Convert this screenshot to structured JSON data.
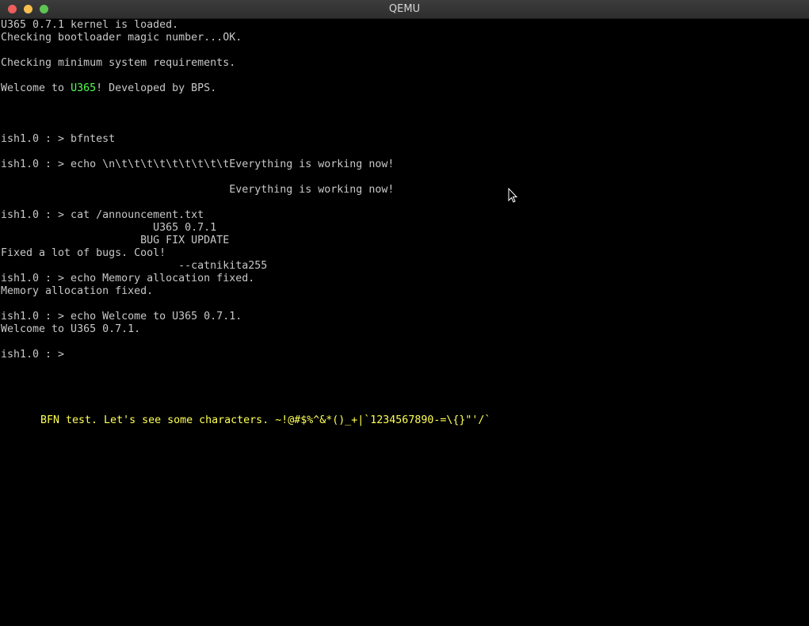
{
  "window": {
    "title": "QEMU",
    "buttons": {
      "close_color": "#ec5f5d",
      "minimize_color": "#f7bf4f",
      "maximize_color": "#5fc454"
    }
  },
  "terminal": {
    "lines": [
      "U365 0.7.1 kernel is loaded.",
      "Checking bootloader magic number...OK.",
      "",
      "Checking minimum system requirements.",
      "",
      "",
      "",
      "",
      "",
      "ish1.0 : > bfntest",
      "",
      "ish1.0 : > echo \\n\\t\\t\\t\\t\\t\\t\\t\\t\\tEverything is working now!",
      "",
      "                                    Everything is working now!",
      "",
      "ish1.0 : > cat /announcement.txt",
      "                        U365 0.7.1",
      "                      BUG FIX UPDATE",
      "Fixed a lot of bugs. Cool!",
      "                            --catnikita255",
      "ish1.0 : > echo Memory allocation fixed.",
      "Memory allocation fixed.",
      "",
      "ish1.0 : > echo Welcome to U365 0.7.1.",
      "Welcome to U365 0.7.1.",
      "",
      "ish1.0 : >"
    ],
    "welcome": {
      "prefix": "Welcome to ",
      "highlight": "U365",
      "suffix": "! Developed by BPS."
    },
    "bfn_test_line": "BFN test. Let's see some characters. ~!@#$%^&*()_+|`1234567890-=\\{}\"'/`",
    "colors": {
      "text": "#c8c8c8",
      "highlight": "#55ff55",
      "bfn": "#ffff55",
      "background": "#000000"
    }
  }
}
